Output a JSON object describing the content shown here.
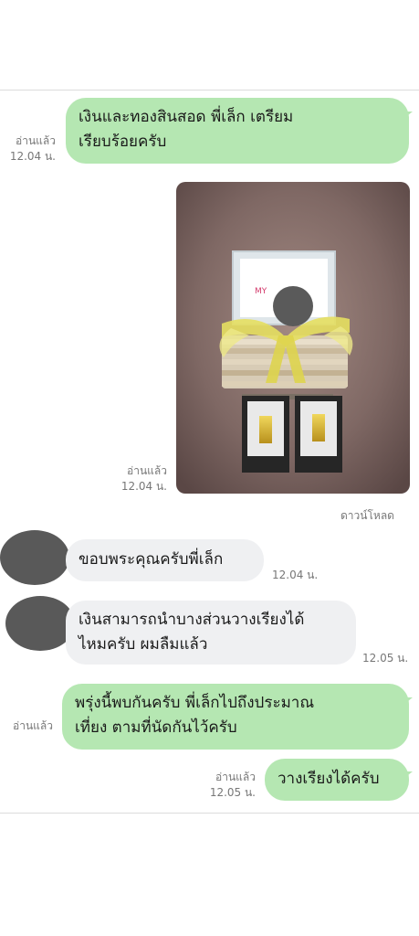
{
  "messages": {
    "m1": {
      "text_line1": "เงินและทองสินสอด พี่เล็ก เตรียม",
      "text_line2": "เรียบร้อยครับ",
      "read": "อ่านแล้ว",
      "time": "12.04 น."
    },
    "photo": {
      "read": "อ่านแล้ว",
      "time": "12.04 น.",
      "download": "ดาวน์โหลด",
      "frame_brand": "MY"
    },
    "m2": {
      "text": "ขอบพระคุณครับพี่เล็ก",
      "time": "12.04 น."
    },
    "m3": {
      "text_line1": "เงินสามารถนำบางส่วนวางเรียงได้",
      "text_line2": "ไหมครับ ผมลืมแล้ว",
      "time": "12.05 น."
    },
    "m4": {
      "text_line1": "พรุ่งนี้พบกันครับ พี่เล็กไปถึงประมาณ",
      "text_line2": "เที่ยง ตามที่นัดกันไว้ครับ",
      "read": "อ่านแล้ว"
    },
    "m5": {
      "text": "วางเรียงได้ครับ",
      "read": "อ่านแล้ว",
      "time": "12.05 น."
    }
  },
  "colors": {
    "outgoing_bubble": "#b5e7b2",
    "incoming_bubble": "#eff0f2",
    "meta_text": "#777777"
  }
}
